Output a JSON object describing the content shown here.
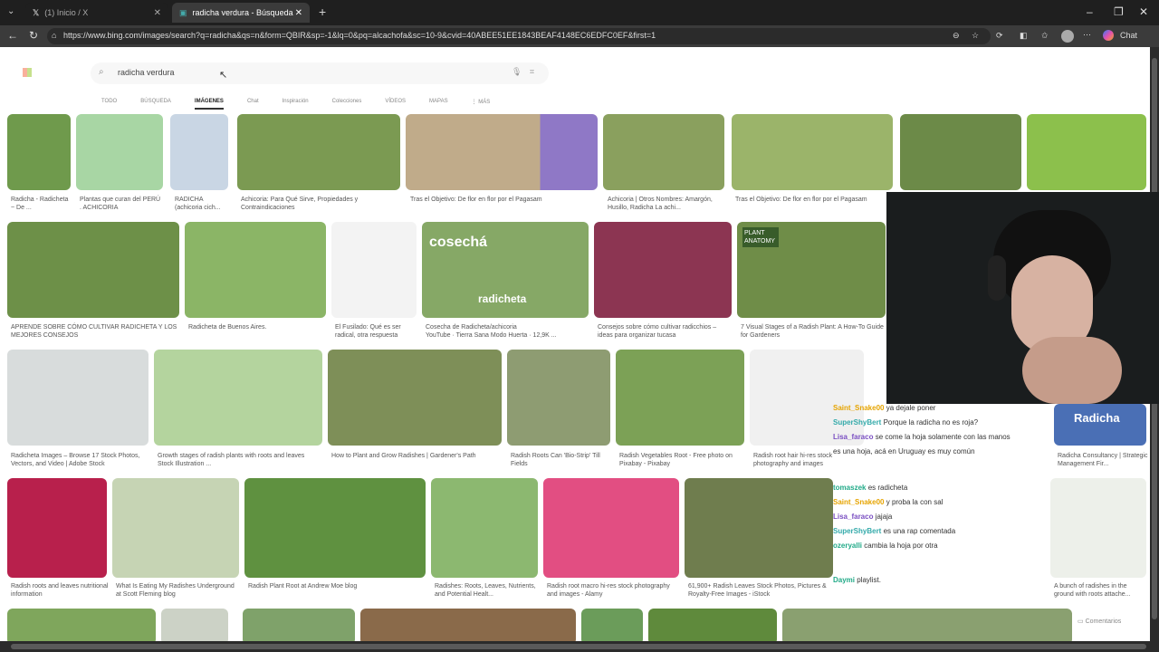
{
  "tabs": [
    {
      "label": "(1) Inicio / X"
    },
    {
      "label": "radicha verdura - Búsqueda Imág"
    }
  ],
  "url": "https://www.bing.com/images/search?q=radicha&qs=n&form=QBIR&sp=-1&lq=0&pq=alcachofa&sc=10-9&cvid=40ABEE51EE1843BEAF4148EC6EDFC0EF&first=1",
  "copilot_label": "Chat",
  "search": {
    "query": "radicha verdura"
  },
  "nav": [
    "TODO",
    "BÚSQUEDA",
    "IMÁGENES",
    "Chat",
    "Inspiración",
    "Colecciones",
    "VÍDEOS",
    "MAPAS",
    "⋮ MÁS"
  ],
  "captions": [
    "Radicha - Radicheta ~ De ...",
    "Plantas que curan del PERÚ . ACHICORIA",
    "RADICHA (achicoria cich...",
    "Achicoria: Para Qué Sirve, Propiedades y Contraindicaciones",
    "Tras el Objetivo: De flor en flor por el Pagasam",
    "Achicoria | Otros Nombres: Amargón, Husillo, Radicha La achi...",
    "Tras el Objetivo: De flor en flor por el Pagasam",
    "APRENDE SOBRE CÓMO CULTIVAR RADICHETA Y LOS MEJORES CONSEJOS",
    "Radicheta de Buenos Aires.",
    "El Fusilado: Qué es ser radical, otra respuesta",
    "Cosecha de Radicheta/achicoria",
    "Consejos sobre cómo cultivar radicchios – ideas para organizar tucasa",
    "7 Visual Stages of a Radish Plant: A How-To Guide for Gardeners",
    "Radicheta Images – Browse 17 Stock Photos, Vectors, and Video | Adobe Stock",
    "Growth stages of radish plants with roots and leaves Stock Illustration ...",
    "How to Plant and Grow Radishes | Gardener's Path",
    "Radish Roots Can 'Bio-Strip' Till Fields",
    "Radish Vegetables Root - Free photo on Pixabay - Pixabay",
    "Radish root hair hi-res stock photography and images",
    "Radicha Consultancy | Strategic Management Fir...",
    "Radish roots and leaves nutritional information",
    "What Is Eating My Radishes Underground at Scott Fleming blog",
    "Radish Plant Root at Andrew Moe blog",
    "Radishes: Roots, Leaves, Nutrients, and Potential Healt...",
    "Radish root macro hi-res stock photography and images - Alamy",
    "61,900+ Radish Leaves Stock Photos, Pictures & Royalty-Free Images - iStock",
    "A bunch of radishes in the ground with roots attache..."
  ],
  "video_meta": "YouTube · Tierra Sana Modo Huerta · 12,9K ...",
  "overlay_texts": {
    "cosecha": "cosechá",
    "radicheta": "radicheta",
    "plant_anatomy": "PLANT ANATOMY",
    "radicha_logo": "Radicha",
    "comments": "Comentarios"
  },
  "chat": [
    {
      "user": "Saint_Snake00",
      "msg": "ya dejale poner"
    },
    {
      "user": "SuperShyBert",
      "msg": "Porque la radicha no es roja?"
    },
    {
      "user": "Lisa_faraco",
      "msg": "se come la hoja solamente con las manos"
    },
    {
      "user": "",
      "msg": "es una hoja, acá en Uruguay es muy común"
    },
    {
      "user": "tomaszek",
      "msg": "es radicheta"
    },
    {
      "user": "Saint_Snake00",
      "msg": "y proba la con sal"
    },
    {
      "user": "Lisa_faraco",
      "msg": "jajaja"
    },
    {
      "user": "SuperShyBert",
      "msg": "es una rap comentada"
    },
    {
      "user": "ozeryalli",
      "msg": "cambia la hoja por otra"
    },
    {
      "user": "Daymi",
      "msg": "playlist."
    }
  ]
}
